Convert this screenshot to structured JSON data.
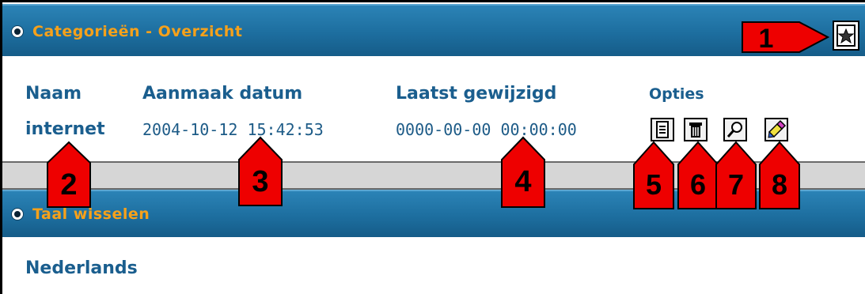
{
  "sections": {
    "overview_title": "Categorieën - Overzicht",
    "language_title": "Taal wisselen"
  },
  "table": {
    "headers": [
      "Naam",
      "Aanmaak datum",
      "Laatst gewijzigd",
      "Opties"
    ],
    "rows": [
      {
        "name": "internet",
        "created": "2004-10-12 15:42:53",
        "modified": "0000-00-00 00:00:00"
      }
    ]
  },
  "language": {
    "current": "Nederlands"
  },
  "icons": {
    "add": "add-category-icon",
    "edit": "edit-document-icon",
    "delete": "trash-icon",
    "view": "magnifier-icon",
    "rename": "pencil-eraser-icon"
  },
  "callouts": [
    "1",
    "2",
    "3",
    "4",
    "5",
    "6",
    "7",
    "8"
  ],
  "colors": {
    "bar": "#1d6e9f",
    "title_orange": "#f7a11a",
    "text_blue": "#1a5e8e",
    "callout_red": "#ee0000"
  }
}
